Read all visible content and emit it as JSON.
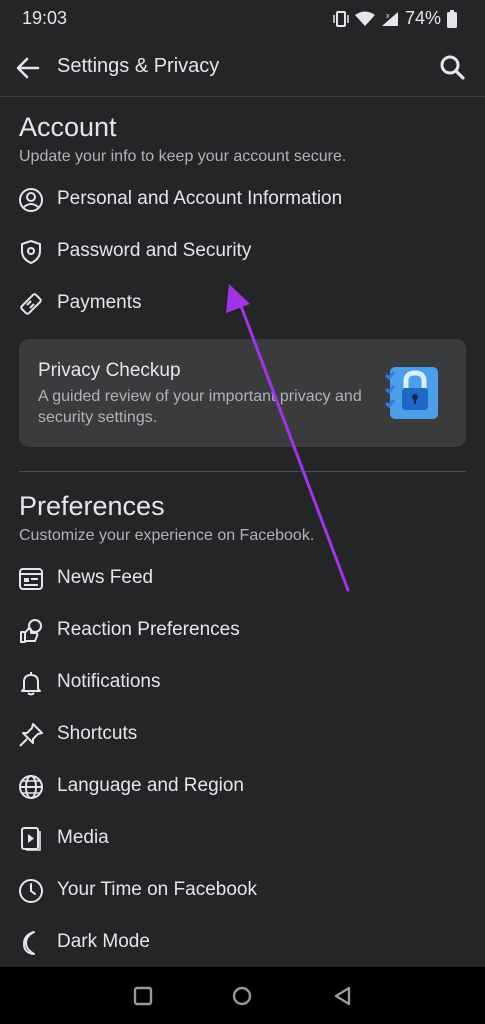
{
  "status": {
    "time": "19:03",
    "battery": "74%"
  },
  "appbar": {
    "title": "Settings & Privacy"
  },
  "account": {
    "title": "Account",
    "subtitle": "Update your info to keep your account secure.",
    "items": [
      {
        "label": "Personal and Account Information",
        "icon": "person-circle-icon"
      },
      {
        "label": "Password and Security",
        "icon": "shield-icon"
      },
      {
        "label": "Payments",
        "icon": "tag-icon"
      }
    ]
  },
  "privacy_card": {
    "title": "Privacy Checkup",
    "description": "A guided review of your important privacy and security settings."
  },
  "preferences": {
    "title": "Preferences",
    "subtitle": "Customize your experience on Facebook.",
    "items": [
      {
        "label": "News Feed",
        "icon": "feed-icon"
      },
      {
        "label": "Reaction Preferences",
        "icon": "reaction-icon"
      },
      {
        "label": "Notifications",
        "icon": "bell-icon"
      },
      {
        "label": "Shortcuts",
        "icon": "pin-icon"
      },
      {
        "label": "Language and Region",
        "icon": "globe-icon"
      },
      {
        "label": "Media",
        "icon": "media-icon"
      },
      {
        "label": "Your Time on Facebook",
        "icon": "clock-icon"
      },
      {
        "label": "Dark Mode",
        "icon": "moon-icon"
      }
    ]
  },
  "colors": {
    "background": "#242526",
    "card": "#3a3b3c",
    "text": "#e4e6eb",
    "secondary_text": "#b0b3b8",
    "arrow": "#a034e6"
  }
}
